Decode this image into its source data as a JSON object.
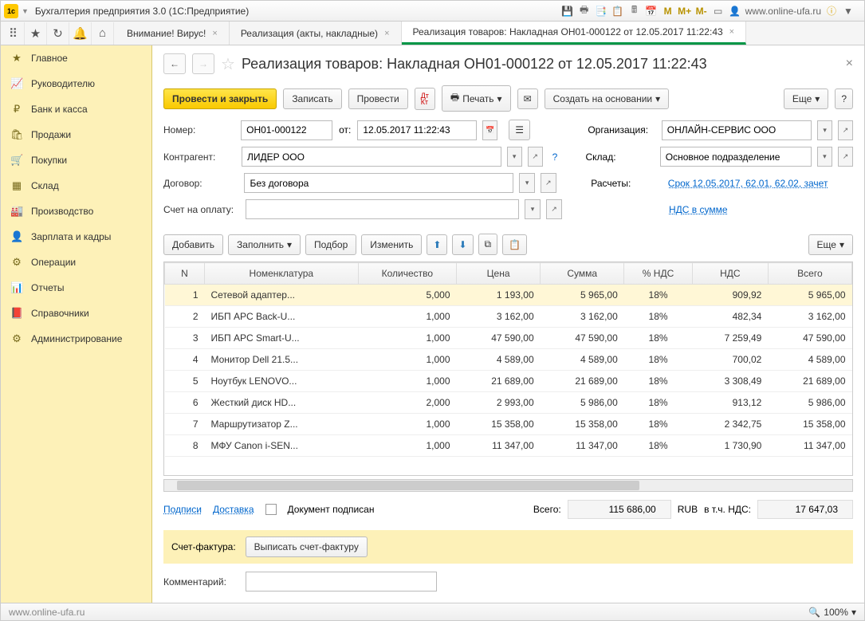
{
  "window": {
    "title": "Бухгалтерия предприятия 3.0   (1С:Предприятие)",
    "site": "www.online-ufa.ru"
  },
  "tabs": [
    {
      "label": "Внимание! Вирус!",
      "active": false
    },
    {
      "label": "Реализация (акты, накладные)",
      "active": false
    },
    {
      "label": "Реализация товаров: Накладная ОН01-000122 от 12.05.2017 11:22:43",
      "active": true
    }
  ],
  "sidebar": {
    "items": [
      "Главное",
      "Руководителю",
      "Банк и касса",
      "Продажи",
      "Покупки",
      "Склад",
      "Производство",
      "Зарплата и кадры",
      "Операции",
      "Отчеты",
      "Справочники",
      "Администрирование"
    ]
  },
  "doc": {
    "title": "Реализация товаров: Накладная ОН01-000122 от 12.05.2017 11:22:43",
    "toolbar": {
      "commit": "Провести и закрыть",
      "save": "Записать",
      "post": "Провести",
      "print": "Печать",
      "createby": "Создать на основании",
      "more": "Еще"
    },
    "fields": {
      "num_lbl": "Номер:",
      "num": "ОН01-000122",
      "from": "от:",
      "date": "12.05.2017 11:22:43",
      "org_lbl": "Организация:",
      "org": "ОНЛАЙН-СЕРВИС ООО",
      "contr_lbl": "Контрагент:",
      "contr": "ЛИДЕР ООО",
      "whs_lbl": "Склад:",
      "whs": "Основное подразделение",
      "dog_lbl": "Договор:",
      "dog": "Без договора",
      "calc_lbl": "Расчеты:",
      "calc_link": "Срок 12.05.2017, 62.01, 62.02, зачет ",
      "inv_lbl": "Счет на оплату:",
      "vat_link": "НДС в сумме"
    },
    "tbltb": {
      "add": "Добавить",
      "fill": "Заполнить",
      "pick": "Подбор",
      "edit": "Изменить",
      "more": "Еще"
    },
    "cols": [
      "N",
      "Номенклатура",
      "Количество",
      "Цена",
      "Сумма",
      "% НДС",
      "НДС",
      "Всего"
    ],
    "rows": [
      {
        "n": 1,
        "name": "Сетевой адаптер...",
        "qty": "5,000",
        "price": "1 193,00",
        "sum": "5 965,00",
        "vatp": "18%",
        "vat": "909,92",
        "tot": "5 965,00"
      },
      {
        "n": 2,
        "name": "ИБП APC Back-U...",
        "qty": "1,000",
        "price": "3 162,00",
        "sum": "3 162,00",
        "vatp": "18%",
        "vat": "482,34",
        "tot": "3 162,00"
      },
      {
        "n": 3,
        "name": "ИБП APC Smart-U...",
        "qty": "1,000",
        "price": "47 590,00",
        "sum": "47 590,00",
        "vatp": "18%",
        "vat": "7 259,49",
        "tot": "47 590,00"
      },
      {
        "n": 4,
        "name": "Монитор Dell 21.5...",
        "qty": "1,000",
        "price": "4 589,00",
        "sum": "4 589,00",
        "vatp": "18%",
        "vat": "700,02",
        "tot": "4 589,00"
      },
      {
        "n": 5,
        "name": "Ноутбук LENOVO...",
        "qty": "1,000",
        "price": "21 689,00",
        "sum": "21 689,00",
        "vatp": "18%",
        "vat": "3 308,49",
        "tot": "21 689,00"
      },
      {
        "n": 6,
        "name": "Жесткий диск HD...",
        "qty": "2,000",
        "price": "2 993,00",
        "sum": "5 986,00",
        "vatp": "18%",
        "vat": "913,12",
        "tot": "5 986,00"
      },
      {
        "n": 7,
        "name": "Маршрутизатор Z...",
        "qty": "1,000",
        "price": "15 358,00",
        "sum": "15 358,00",
        "vatp": "18%",
        "vat": "2 342,75",
        "tot": "15 358,00"
      },
      {
        "n": 8,
        "name": "МФУ Canon i-SEN...",
        "qty": "1,000",
        "price": "11 347,00",
        "sum": "11 347,00",
        "vatp": "18%",
        "vat": "1 730,90",
        "tot": "11 347,00"
      }
    ],
    "footer": {
      "sign": "Подписи",
      "deliv": "Доставка",
      "signed": "Документ подписан",
      "tot_lbl": "Всего:",
      "total": "115 686,00",
      "cur": "RUB",
      "vat_lbl": "в т.ч. НДС:",
      "vat": "17 647,03",
      "sf_lbl": "Счет-фактура:",
      "sf_btn": "Выписать счет-фактуру",
      "comm_lbl": "Комментарий:"
    }
  },
  "status": {
    "watermark": "www.online-ufa.ru",
    "zoom": "100%"
  }
}
